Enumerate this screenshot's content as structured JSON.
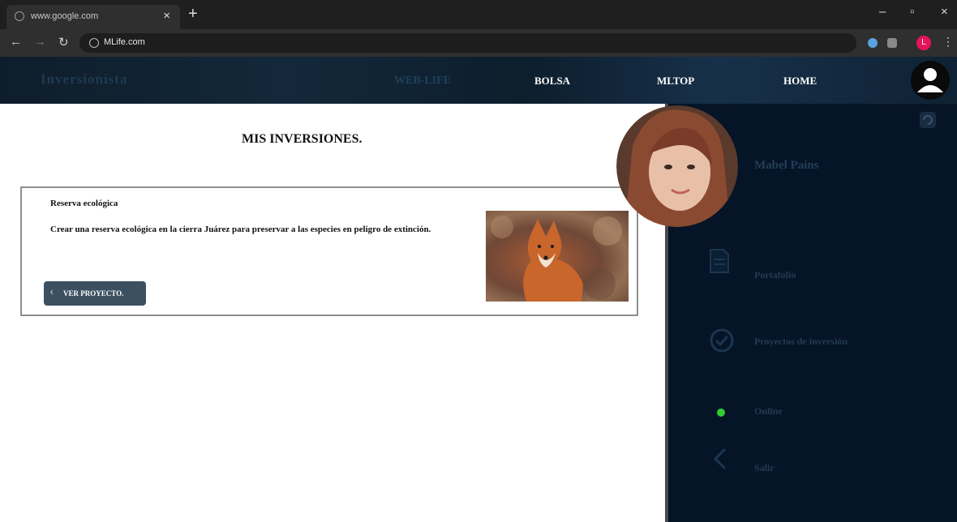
{
  "browser": {
    "tab_title": "www.google.com",
    "tab_close": "×",
    "new_tab": "+",
    "url": "MLife.com",
    "window_minimize": "–",
    "window_maximize": "▫",
    "window_close": "×",
    "profile_initial": "L"
  },
  "header": {
    "brand": "Inversionista",
    "nav": [
      "WEB-LIFE",
      "BOLSA",
      "MLTOP",
      "HOME"
    ]
  },
  "main": {
    "title": "MIS INVERSIONES.",
    "card": {
      "title": "Reserva ecológica",
      "description": "Crear una reserva ecológica en la cierra Juárez para preservar a las especies en peligro de extinción.",
      "button_label": "VER PROYECTO."
    }
  },
  "sidebar": {
    "username": "Mabel Pains",
    "items": [
      {
        "label": "Portafolio",
        "icon": "document-icon"
      },
      {
        "label": "Proyectos de inversión",
        "icon": "check-circle-icon"
      },
      {
        "label": "Online",
        "icon": "status-dot-icon"
      },
      {
        "label": "Salir",
        "icon": "chevron-left-icon"
      }
    ]
  },
  "colors": {
    "header_bg": "#0f2233",
    "sidebar_bg": "#061427",
    "button_bg": "#3b5061",
    "status_online": "#2fcf32",
    "profile_badge": "#e4145a"
  }
}
